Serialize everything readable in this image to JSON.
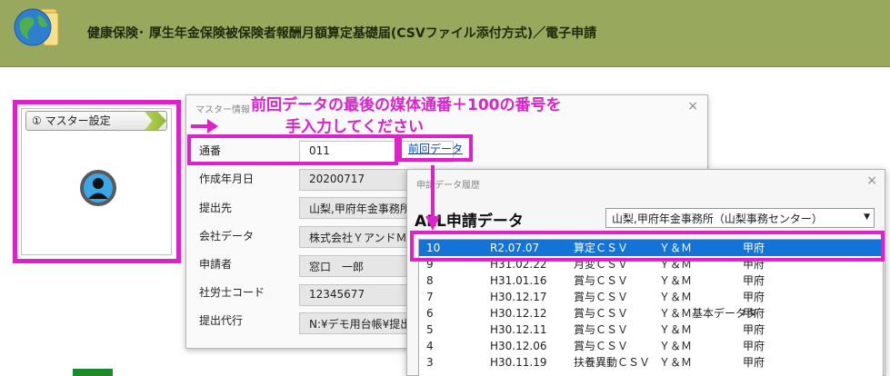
{
  "header": {
    "title": "健康保険･ 厚生年金保険被保険者報酬月額算定基礎届(CSVファイル添付方式)／電子申請"
  },
  "master_panel": {
    "button_label": "①  マスター設定"
  },
  "master_dialog": {
    "title": "マスター情報",
    "close": "×",
    "prev_link": "前回データ",
    "fields": [
      {
        "label": "通番",
        "value": "011"
      },
      {
        "label": "作成年月日",
        "value": "20200717"
      },
      {
        "label": "提出先",
        "value": "山梨,甲府年金事務所"
      },
      {
        "label": "会社データ",
        "value": "株式会社ＹアンドＭ"
      },
      {
        "label": "申請者",
        "value": "窓口　一郎"
      },
      {
        "label": "社労士コード",
        "value": "12345677"
      },
      {
        "label": "提出代行",
        "value": "N:¥デモ用台帳¥提出"
      }
    ]
  },
  "instruction": {
    "line1": "前回データの最後の媒体通番＋100の番号を",
    "line2": "手入力してください"
  },
  "history_dialog": {
    "title": "申請データ履歴",
    "close": "×",
    "heading": "ALL申請データ",
    "office_select": "山梨,甲府年金事務所（山梨事務センター）",
    "rows": [
      {
        "no": "10",
        "date": "R2.07.07",
        "type": "算定ＣＳＶ",
        "company": "Ｙ＆Ｍ",
        "office": "甲府",
        "selected": true
      },
      {
        "no": "9",
        "date": "H31.02.22",
        "type": "月変ＣＳＶ",
        "company": "Ｙ＆Ｍ",
        "office": "甲府"
      },
      {
        "no": "8",
        "date": "H31.01.16",
        "type": "賞与ＣＳＶ",
        "company": "Ｙ＆Ｍ",
        "office": "甲府"
      },
      {
        "no": "7",
        "date": "H30.12.17",
        "type": "賞与ＣＳＶ",
        "company": "Ｙ＆Ｍ",
        "office": "甲府"
      },
      {
        "no": "6",
        "date": "H30.12.12",
        "type": "賞与ＣＳＶ",
        "company": "Ｙ＆Ｍ基本データタ",
        "office": "甲府"
      },
      {
        "no": "5",
        "date": "H30.12.11",
        "type": "賞与ＣＳＶ",
        "company": "Ｙ＆Ｍ",
        "office": "甲府"
      },
      {
        "no": "4",
        "date": "H30.12.06",
        "type": "賞与ＣＳＶ",
        "company": "Ｙ＆Ｍ",
        "office": "甲府"
      },
      {
        "no": "3",
        "date": "H30.11.19",
        "type": "扶養異動ＣＳＶ",
        "company": "Ｙ＆Ｍ",
        "office": "甲府"
      }
    ]
  },
  "colors": {
    "header_bg": "#98a85c",
    "highlight": "#dd22cc",
    "selection": "#1473d6",
    "link": "#0044cc"
  }
}
